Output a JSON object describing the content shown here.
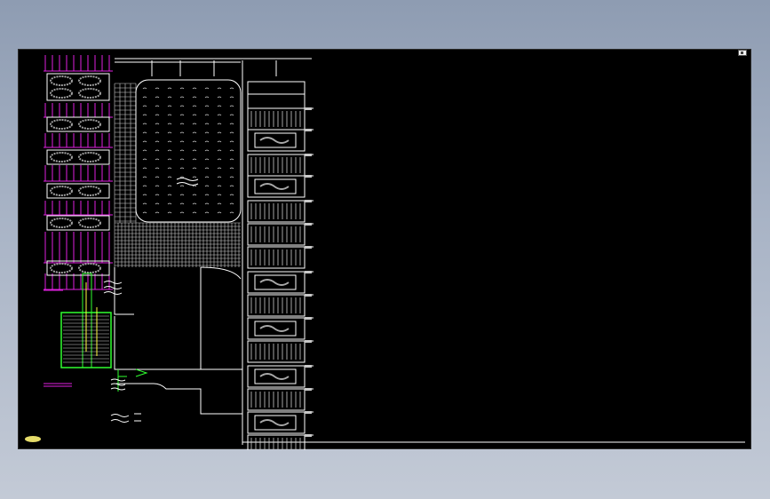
{
  "window": {
    "background_gradient": [
      "#8e9cb2",
      "#c3cad6"
    ],
    "viewport_background": "#000000"
  },
  "colors": {
    "magenta": "#e020e0",
    "white": "#ffffff",
    "grey": "#9a9a9a",
    "green": "#30ff30",
    "yellow": "#ffff40",
    "marker": "#e6dc6a"
  },
  "icons": [
    "ucs-icon",
    "cursor-marker"
  ]
}
